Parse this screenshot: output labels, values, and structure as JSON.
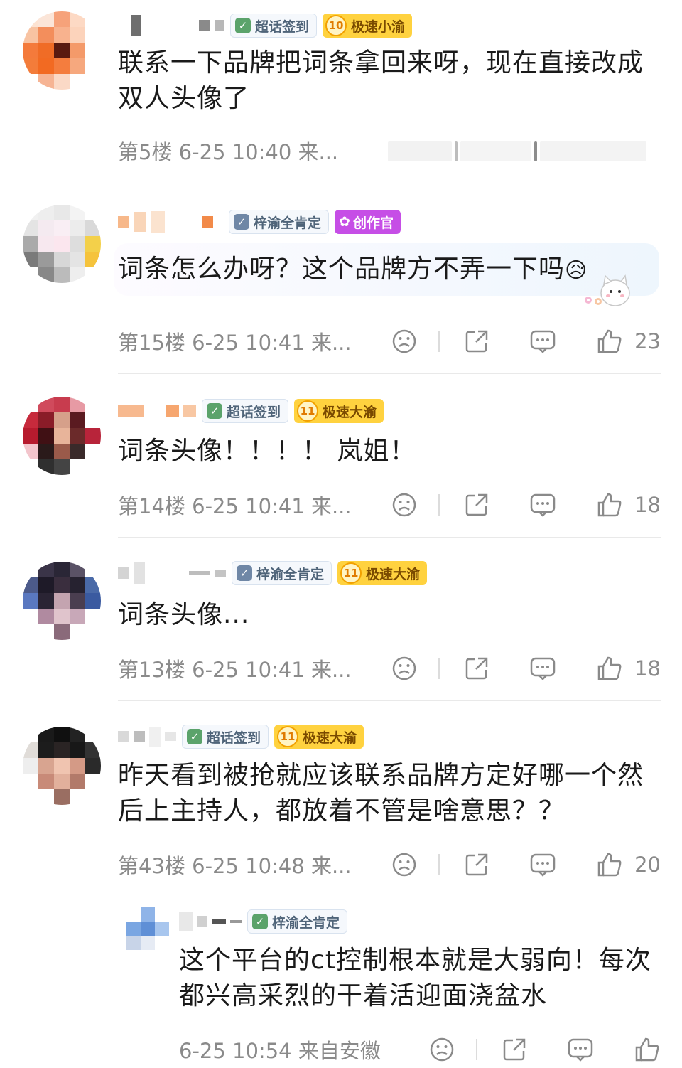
{
  "comments": [
    {
      "id": "c5",
      "badges": {
        "topic": "超话签到",
        "level_num": "10",
        "level_text": "极速小渝"
      },
      "text": "联系一下品牌把词条拿回来呀，现在直接改成双人头像了",
      "meta": "第5楼 6-25 10:40 来..."
    },
    {
      "id": "c15",
      "badges": {
        "topic": "梓渝全肯定",
        "creator": "创作官"
      },
      "text": "词条怎么办呀？这个品牌方不弄一下吗",
      "emoji": "😥",
      "meta": "第15楼 6-25 10:41 来...",
      "likes": "23"
    },
    {
      "id": "c14",
      "badges": {
        "topic": "超话签到",
        "level_num": "11",
        "level_text": "极速大渝"
      },
      "text": "词条头像！！！！ 岚姐！",
      "meta": "第14楼 6-25 10:41 来...",
      "likes": "18"
    },
    {
      "id": "c13",
      "badges": {
        "topic": "梓渝全肯定",
        "level_num": "11",
        "level_text": "极速大渝"
      },
      "text": "词条头像...",
      "meta": "第13楼 6-25 10:41 来...",
      "likes": "18"
    },
    {
      "id": "c43",
      "badges": {
        "topic": "超话签到",
        "level_num": "11",
        "level_text": "极速大渝"
      },
      "text": "昨天看到被抢就应该联系品牌方定好哪一个然后上主持人，都放着不管是啥意思？？",
      "meta": "第43楼 6-25 10:48 来...",
      "likes": "20"
    },
    {
      "id": "r1",
      "badges": {
        "topic": "梓渝全肯定"
      },
      "text": "这个平台的ct控制根本就是大弱向！每次都兴高采烈的干着活迎面浇盆水",
      "meta": "6-25 10:54 来自安徽"
    }
  ],
  "colors": {
    "accent_level": "#ffd23f",
    "creator": "#c64ee6",
    "meta": "#8a8a8a"
  },
  "icons": [
    "sad-face-icon",
    "share-icon",
    "comment-icon",
    "like-icon"
  ]
}
